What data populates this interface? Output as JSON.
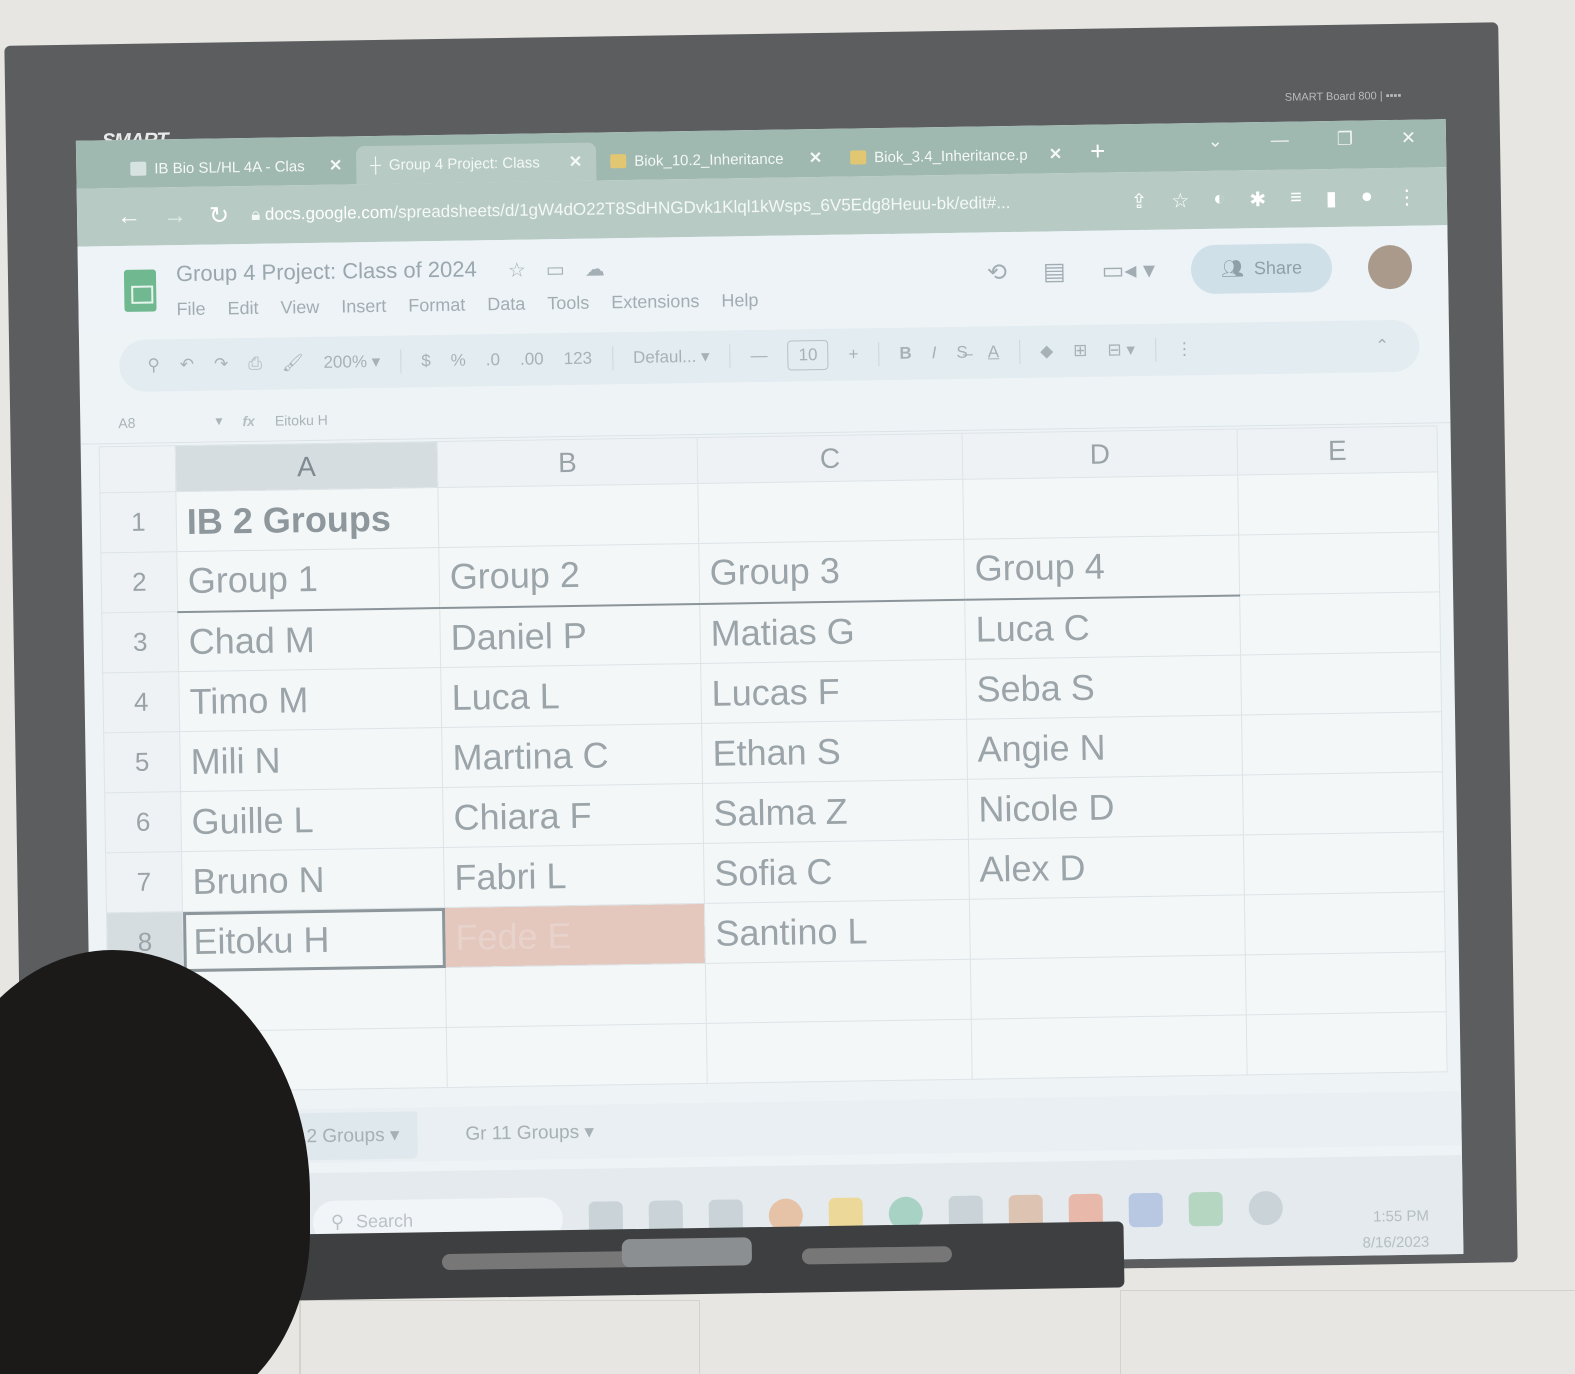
{
  "bezel": {
    "brand": "SMART",
    "model": "SMART Board 800 | ▪▪▪▪"
  },
  "browser": {
    "tabs": [
      {
        "label": "IB Bio SL/HL 4A - Clas",
        "close": "✕"
      },
      {
        "label": "Group 4 Project: Class",
        "close": "✕"
      },
      {
        "label": "Biok_10.2_Inheritance",
        "close": "✕"
      },
      {
        "label": "Biok_3.4_Inheritance.p",
        "close": "✕"
      }
    ],
    "new_tab": "+",
    "url_host": "docs.google.com",
    "url_path": "/spreadsheets/d/1gW4dO22T8SdHNGDvk1Klql1kWsps_6V5Edg8Heuu-bk/edit#..."
  },
  "sheets": {
    "doc_title": "Group 4 Project: Class of 2024",
    "menu": [
      "File",
      "Edit",
      "View",
      "Insert",
      "Format",
      "Data",
      "Tools",
      "Extensions",
      "Help"
    ],
    "share_label": "Share",
    "toolbar": {
      "zoom": "200%",
      "currency": "$",
      "percent": "%",
      "dec_decrease": ".0",
      "dec_increase": ".00",
      "number_format": "123",
      "font": "Defaul...",
      "font_size": "10",
      "bold": "B",
      "italic": "I",
      "text_color": "A"
    },
    "name_box": "A8",
    "formula": "Eitoku H",
    "columns": [
      "A",
      "B",
      "C",
      "D",
      "E"
    ],
    "rows": [
      {
        "n": "1",
        "cells": [
          "IB 2 Groups",
          "",
          "",
          "",
          ""
        ]
      },
      {
        "n": "2",
        "cells": [
          "Group 1",
          "Group 2",
          "Group 3",
          "Group 4",
          ""
        ]
      },
      {
        "n": "3",
        "cells": [
          "Chad M",
          "Daniel P",
          "Matias G",
          "Luca C",
          ""
        ]
      },
      {
        "n": "4",
        "cells": [
          "Timo M",
          "Luca L",
          "Lucas F",
          "Seba S",
          ""
        ]
      },
      {
        "n": "5",
        "cells": [
          "Mili N",
          "Martina C",
          "Ethan S",
          "Angie N",
          ""
        ]
      },
      {
        "n": "6",
        "cells": [
          "Guille L",
          "Chiara F",
          "Salma Z",
          "Nicole D",
          ""
        ]
      },
      {
        "n": "7",
        "cells": [
          "Bruno N",
          "Fabri L",
          "Sofia C",
          "Alex D",
          ""
        ]
      },
      {
        "n": "8",
        "cells": [
          "Eitoku H",
          "Fede E",
          "Santino L",
          "",
          ""
        ]
      },
      {
        "n": "",
        "cells": [
          "",
          "",
          "",
          "",
          ""
        ]
      },
      {
        "n": "",
        "cells": [
          "",
          "",
          "",
          "",
          ""
        ]
      }
    ],
    "sheet_tabs": [
      "Gr 12 Groups",
      "Gr 11 Groups"
    ]
  },
  "taskbar": {
    "search_placeholder": "Search",
    "time": "1:55 PM",
    "date": "8/16/2023"
  }
}
